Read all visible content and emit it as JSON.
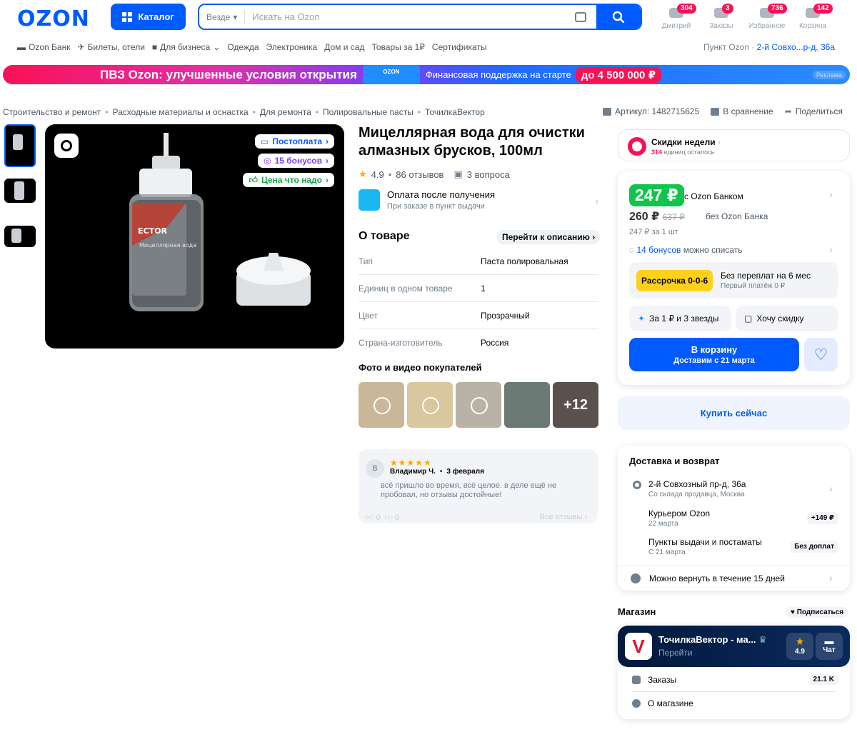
{
  "header": {
    "logo": "OZON",
    "catalog_label": "Каталог",
    "search_scope": "Везде",
    "search_placeholder": "Искать на Ozon",
    "icons": [
      {
        "label": "Дмитрий",
        "badge": "304",
        "icon": "user-icon"
      },
      {
        "label": "Заказы",
        "badge": "3",
        "icon": "box-icon"
      },
      {
        "label": "Избранное",
        "badge": "736",
        "icon": "heart-icon"
      },
      {
        "label": "Корзина",
        "badge": "142",
        "icon": "cart-icon"
      }
    ]
  },
  "nav": {
    "items": [
      "Ozon Банк",
      "Билеты, отели",
      "Для бизнеса",
      "Одежда",
      "Электроника",
      "Дом и сад",
      "Товары за 1₽",
      "Сертификаты"
    ],
    "pickup_label": "Пункт Ozon",
    "pickup_value": "2-й Совхо...р-д, 36а"
  },
  "banner": {
    "title": "ПВЗ Ozon: улучшенные условия открытия",
    "box_label": "OZON",
    "text": "Финансовая поддержка на старте",
    "amount": "до 4 500 000 ₽",
    "ad": "Реклама"
  },
  "breadcrumbs": [
    "Строительство и ремонт",
    "Расходные материалы и оснастка",
    "Для ремонта",
    "Полировальные пасты",
    "ТочилкаВектор"
  ],
  "meta": {
    "article": "Артикул: 1482715625",
    "compare": "В сравнение",
    "share": "Поделиться"
  },
  "gallery": {
    "badges": [
      "Постоплата",
      "15 бонусов",
      "Цена что надо"
    ],
    "label_brand": "ECTOR",
    "label_text": "Мицеллярная вода"
  },
  "product": {
    "title": "Мицеллярная вода для очистки алмазных брусков, 100мл",
    "rating": "4.9",
    "reviews": "86 отзывов",
    "questions": "3 вопроса",
    "pay_after_title": "Оплата после получения",
    "pay_after_sub": "При заказе в пункт выдачи"
  },
  "about": {
    "title": "О товаре",
    "goto": "Перейти к описанию",
    "specs": [
      {
        "k": "Тип",
        "v": "Паста полировальная"
      },
      {
        "k": "Единиц в одном товаре",
        "v": "1"
      },
      {
        "k": "Цвет",
        "v": "Прозрачный"
      },
      {
        "k": "Страна-изготовитель",
        "v": "Россия"
      }
    ]
  },
  "ugc": {
    "title": "Фото и видео покупателей",
    "more": "+12"
  },
  "review": {
    "avatar": "В",
    "author": "Владимир Ч.",
    "date": "3 февраля",
    "text": "всё пришло во время, всё целое. в деле ещё не пробовал, но отзывы достойные!",
    "likes": "0",
    "dislikes": "0",
    "all": "Все отзывы"
  },
  "deal": {
    "title": "Скидки недели",
    "count": "314",
    "rest": "единиц осталось"
  },
  "price": {
    "bank_price": "247 ₽",
    "bank_label": "с Ozon Банком",
    "price": "260 ₽",
    "old_price": "637 ₽",
    "no_bank_label": "без Ozon Банка",
    "per_unit": "247 ₽ за 1 шт",
    "bonus_count": "14 бонусов",
    "bonus_text": "можно списать",
    "installment_tag": "Рассрочка 0-0-6",
    "installment_title": "Без переплат на 6 мес",
    "installment_sub": "Первый платёж 0 ₽",
    "promo1": "За 1 ₽ и 3 звезды",
    "promo2": "Хочу скидку",
    "cart_label": "В корзину",
    "cart_sub": "Доставим с 21 марта",
    "buy_now": "Купить сейчас"
  },
  "delivery": {
    "title": "Доставка и возврат",
    "address": "2-й Совхозный пр-д, 36а",
    "address_sub": "Со склада продавца, Москва",
    "courier": "Курьером Ozon",
    "courier_date": "22 марта",
    "courier_price": "+149 ₽",
    "points": "Пункты выдачи и постаматы",
    "points_date": "С 21 марта",
    "points_price": "Без доплат",
    "return": "Можно вернуть в течение 15 дней"
  },
  "shop": {
    "section_title": "Магазин",
    "subscribe": "Подписаться",
    "logo_letter": "V",
    "name": "ТочилкаВектор - ма...",
    "go": "Перейти",
    "rating": "4.9",
    "chat": "Чат",
    "orders_label": "Заказы",
    "orders_value": "21.1 K",
    "about_label": "О магазине"
  },
  "colors": {
    "brand_blue": "#005bff",
    "price_green": "#10c44c",
    "accent_pink": "#f91155",
    "star": "#ffa800"
  }
}
